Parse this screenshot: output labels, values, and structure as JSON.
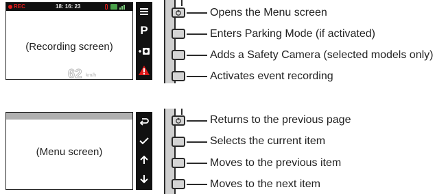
{
  "recording_screen": {
    "status": {
      "rec": "REC",
      "time": "18: 16: 23"
    },
    "caption": "(Recording screen)",
    "speed": {
      "value": "62",
      "unit": "km/h"
    },
    "sidebar_icons": [
      "menu-icon",
      "parking-icon",
      "safety-camera-icon",
      "event-warning-icon"
    ],
    "parking_glyph": "P",
    "buttons": [
      "Opens the Menu screen",
      "Enters Parking Mode (if activated)",
      "Adds a Safety Camera (selected models only)",
      "Activates event recording"
    ]
  },
  "menu_screen": {
    "caption": "(Menu screen)",
    "sidebar_icons": [
      "back-arrow-icon",
      "checkmark-icon",
      "arrow-up-icon",
      "arrow-down-icon"
    ],
    "buttons": [
      "Returns to the previous page",
      "Selects the current item",
      "Moves to the previous item",
      "Moves to the next item"
    ]
  },
  "colors": {
    "rec_red": "#e01a1a",
    "warning_red": "#e01a1a",
    "screen_border": "#222222",
    "bar_black": "#111111"
  }
}
